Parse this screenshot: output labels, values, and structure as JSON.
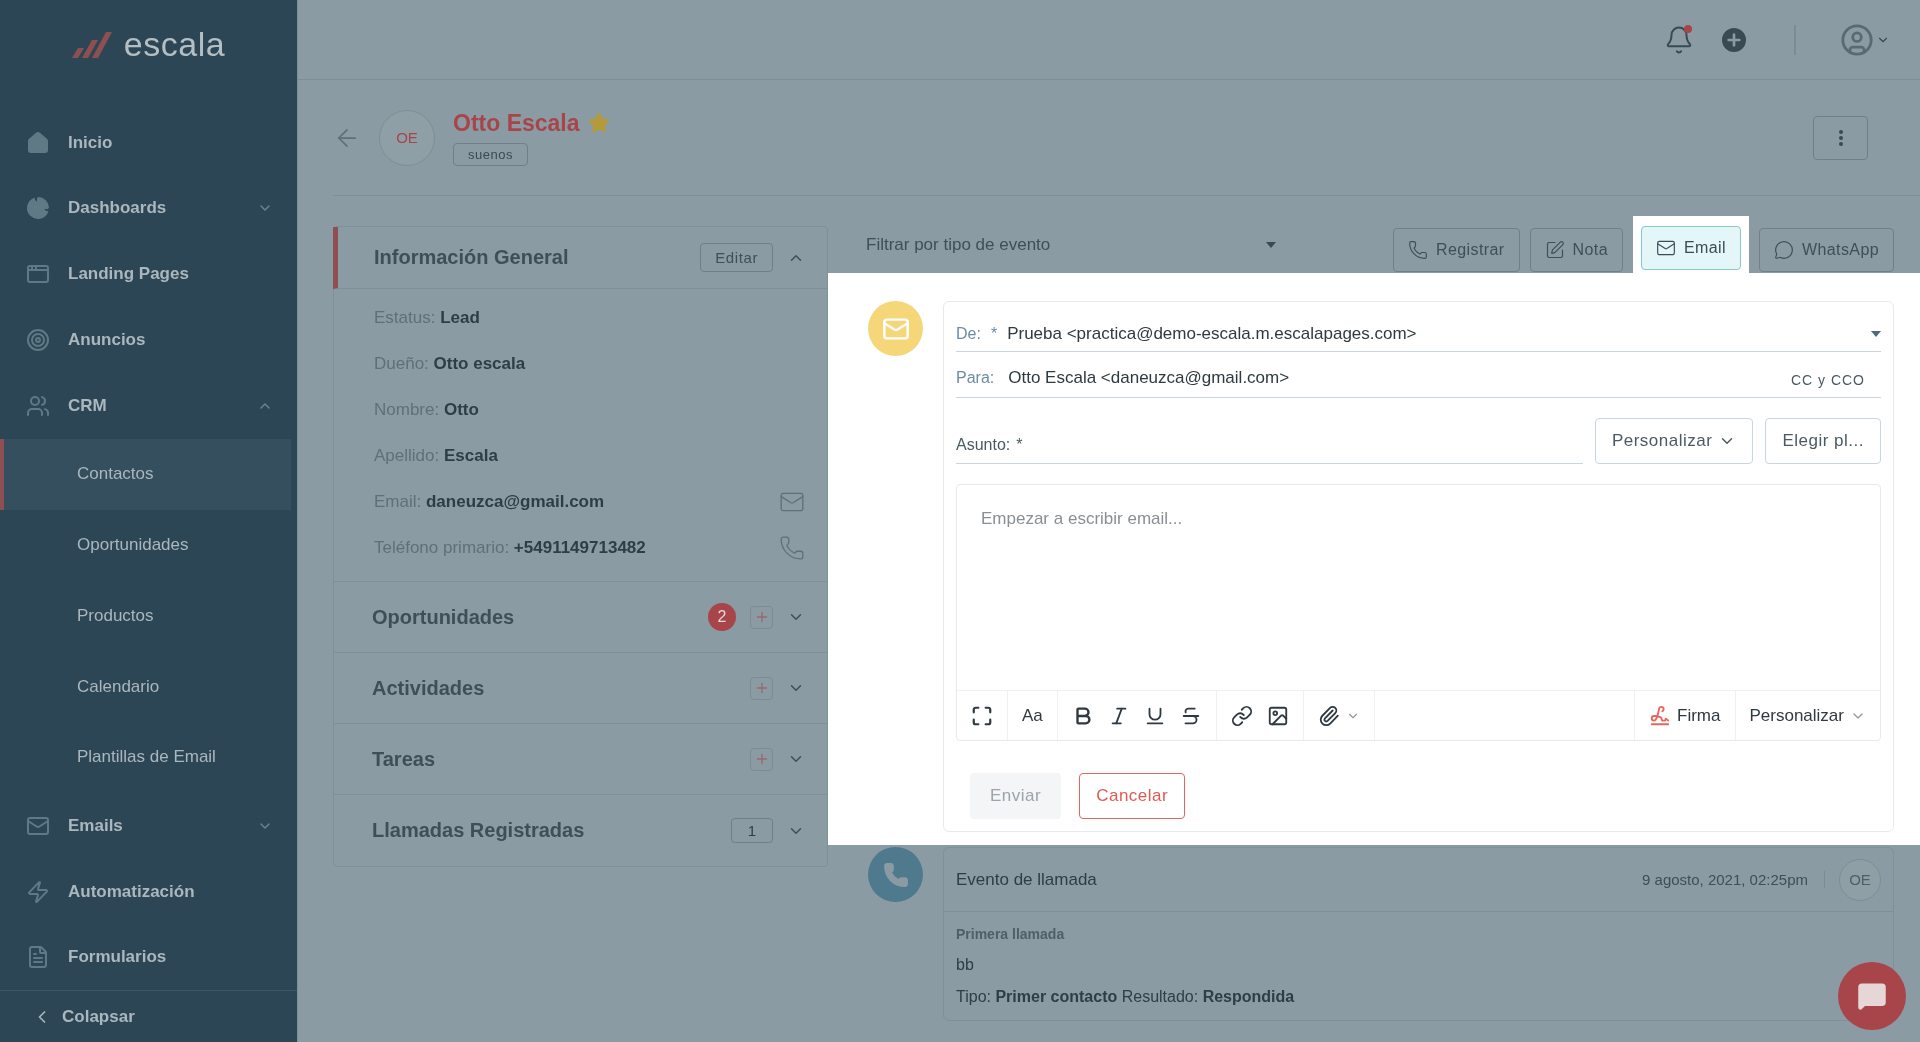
{
  "brand": {
    "name": "escala"
  },
  "sidebar": {
    "items": [
      {
        "label": "Inicio"
      },
      {
        "label": "Dashboards",
        "expanded": false
      },
      {
        "label": "Landing Pages"
      },
      {
        "label": "Anuncios"
      },
      {
        "label": "CRM",
        "expanded": true,
        "children": [
          {
            "label": "Contactos",
            "selected": true
          },
          {
            "label": "Oportunidades",
            "selected": false
          },
          {
            "label": "Productos",
            "selected": false
          },
          {
            "label": "Calendario",
            "selected": false
          },
          {
            "label": "Plantillas de Email",
            "selected": false
          }
        ]
      },
      {
        "label": "Emails",
        "expanded": false
      },
      {
        "label": "Automatización"
      },
      {
        "label": "Formularios"
      }
    ],
    "collapse_label": "Colapsar"
  },
  "contact": {
    "initials": "OE",
    "name": "Otto Escala",
    "starred": true,
    "tag": "suenos"
  },
  "general_info": {
    "title": "Información General",
    "edit_label": "Editar",
    "expanded": true,
    "fields": [
      {
        "label": "Estatus:",
        "value": "Lead"
      },
      {
        "label": "Dueño:",
        "value": "Otto escala"
      },
      {
        "label": "Nombre:",
        "value": "Otto"
      },
      {
        "label": "Apellido:",
        "value": "Escala"
      },
      {
        "label": "Email:",
        "value": "daneuzca@gmail.com",
        "kind": "email"
      },
      {
        "label": "Teléfono primario:",
        "value": "+5491149713482",
        "kind": "phone"
      }
    ]
  },
  "sections": [
    {
      "title": "Oportunidades",
      "kind": "badge",
      "count": "2",
      "addable": true
    },
    {
      "title": "Actividades",
      "kind": "plain",
      "addable": true
    },
    {
      "title": "Tareas",
      "kind": "plain",
      "addable": true
    },
    {
      "title": "Llamadas Registradas",
      "kind": "counter",
      "count": "1",
      "addable": false
    }
  ],
  "timeline": {
    "filter_placeholder": "Filtrar por tipo de evento",
    "actions": [
      {
        "label": "Registrar",
        "kind": "phone",
        "selected": false
      },
      {
        "label": "Nota",
        "kind": "note",
        "selected": false
      },
      {
        "label": "Email",
        "kind": "email",
        "selected": true
      },
      {
        "label": "WhatsApp",
        "kind": "chat",
        "selected": false
      }
    ]
  },
  "composer": {
    "from_label": "De:",
    "from_required": "*",
    "from_value": "Prueba <practica@demo-escala.m.escalapages.com>",
    "to_label": "Para:",
    "to_value": "Otto Escala <daneuzca@gmail.com>",
    "cc_label": "CC y CCO",
    "subject_label": "Asunto:",
    "subject_required": "*",
    "personalize_label": "Personalizar",
    "template_label": "Elegir pl...",
    "body_placeholder": "Empezar a escribir email...",
    "font_label": "Aa",
    "signature_label": "Firma",
    "toolbar_personalize_label": "Personalizar",
    "send_label": "Enviar",
    "send_disabled": true,
    "cancel_label": "Cancelar"
  },
  "events": [
    {
      "title": "Evento de llamada",
      "date": "9 agosto, 2021, 02:25pm",
      "initials": "OE",
      "subtitle": "Primera llamada",
      "body": "bb",
      "type_label": "Tipo:",
      "type_value": "Primer contacto",
      "result_label": "Resultado:",
      "result_value": "Respondida"
    }
  ]
}
